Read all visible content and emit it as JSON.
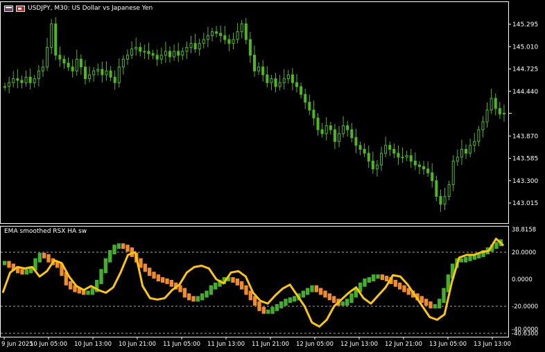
{
  "header": {
    "symbol_text": "USDJPY, M30:  US Dollar vs Japanese Yen"
  },
  "subwindow": {
    "title": "EMA smoothed RSX HA sw"
  },
  "chart_data": [
    {
      "type": "candlestick",
      "symbol": "USDJPY",
      "timeframe": "M30",
      "colors": {
        "candle": "#4cbb17",
        "background": "#000000",
        "frame": "#ffffff"
      },
      "price_ticks": [
        "145.295",
        "145.010",
        "144.725",
        "144.440",
        "143.870",
        "143.585",
        "143.300",
        "143.015"
      ],
      "current_price": 144.16,
      "close_series": [
        144.5,
        144.55,
        144.6,
        144.58,
        144.55,
        144.62,
        144.55,
        144.6,
        144.7,
        144.75,
        145.0,
        145.3,
        144.9,
        144.85,
        144.8,
        144.75,
        144.7,
        144.85,
        144.75,
        144.6,
        144.65,
        144.7,
        144.72,
        144.65,
        144.7,
        144.62,
        144.55,
        144.75,
        144.85,
        144.9,
        144.98,
        145.0,
        144.95,
        144.95,
        144.92,
        144.9,
        144.85,
        144.9,
        144.95,
        144.88,
        144.95,
        144.9,
        144.95,
        145.0,
        145.05,
        144.98,
        145.05,
        145.1,
        145.15,
        145.2,
        145.18,
        145.15,
        145.1,
        145.05,
        145.1,
        145.2,
        145.3,
        145.1,
        144.9,
        144.7,
        144.75,
        144.65,
        144.55,
        144.6,
        144.5,
        144.55,
        144.6,
        144.65,
        144.55,
        144.5,
        144.4,
        144.3,
        144.2,
        144.1,
        143.95,
        143.9,
        144.0,
        143.95,
        143.8,
        143.9,
        144.0,
        143.95,
        143.85,
        143.75,
        143.7,
        143.65,
        143.55,
        143.45,
        143.5,
        143.65,
        143.75,
        143.7,
        143.65,
        143.6,
        143.6,
        143.62,
        143.55,
        143.5,
        143.48,
        143.45,
        143.4,
        143.3,
        143.1,
        143.0,
        143.1,
        143.25,
        143.55,
        143.6,
        143.7,
        143.65,
        143.75,
        143.8,
        143.95,
        144.05,
        144.2,
        144.35,
        144.22,
        144.15,
        144.16
      ],
      "x_ticks": [
        "9 Jun 2025",
        "10 Jun 05:00",
        "10 Jun 13:00",
        "10 Jun 21:00",
        "11 Jun 05:00",
        "11 Jun 13:00",
        "11 Jun 21:00",
        "12 Jun 05:00",
        "12 Jun 13:00",
        "12 Jun 21:00",
        "13 Jun 05:00",
        "13 Jun 13:00"
      ]
    },
    {
      "type": "line",
      "title": "EMA smoothed RSX HA sw",
      "y_ticks": [
        "38.8158",
        "20.0000",
        "0.0000",
        "-20.0000",
        "-40.0000",
        "-40.6300"
      ],
      "levels": [
        20,
        -20
      ],
      "ylim": [
        -40.63,
        38.8158
      ],
      "colors": {
        "line": "#ffc700",
        "up": "#43b02a",
        "down": "#f28c28"
      },
      "rsx_series": [
        -10,
        5,
        9,
        8,
        9,
        2,
        6,
        14,
        12,
        2,
        -5,
        -8,
        -5,
        -8,
        -10,
        -6,
        5,
        18,
        20,
        -5,
        -14,
        -15,
        -14,
        -8,
        -4,
        5,
        9,
        10,
        8,
        0,
        -3,
        5,
        6,
        2,
        -10,
        -16,
        -18,
        -12,
        -7,
        -4,
        -12,
        -20,
        -32,
        -35,
        -30,
        -20,
        -15,
        -10,
        -6,
        -14,
        -18,
        -12,
        -6,
        3,
        2,
        -4,
        -12,
        -20,
        -28,
        -30,
        -26,
        -2,
        16,
        18,
        18,
        20,
        21,
        30,
        25
      ],
      "histogram_series": [
        12,
        10,
        8,
        6,
        5,
        6,
        8,
        14,
        18,
        17,
        14,
        12,
        10,
        4,
        -3,
        -6,
        -8,
        -9,
        -10,
        -10,
        -8,
        -2,
        6,
        14,
        20,
        24,
        25,
        24,
        22,
        18,
        14,
        10,
        7,
        4,
        2,
        0,
        -1,
        -2,
        -4,
        -6,
        -8,
        -12,
        -14,
        -15,
        -14,
        -12,
        -10,
        -6,
        -4,
        -2,
        0,
        0,
        -1,
        -3,
        -6,
        -10,
        -14,
        -18,
        -22,
        -24,
        -24,
        -22,
        -20,
        -18,
        -16,
        -15,
        -14,
        -12,
        -10,
        -8,
        -6,
        -8,
        -10,
        -12,
        -14,
        -16,
        -18,
        -18,
        -16,
        -12,
        -8,
        -4,
        -1,
        0,
        2,
        2,
        1,
        0,
        -2,
        -4,
        -6,
        -8,
        -10,
        -12,
        -14,
        -16,
        -18,
        -20,
        -20,
        -16,
        -8,
        2,
        10,
        14,
        14,
        15,
        16,
        17,
        18,
        20,
        22,
        24,
        26,
        28
      ]
    }
  ]
}
